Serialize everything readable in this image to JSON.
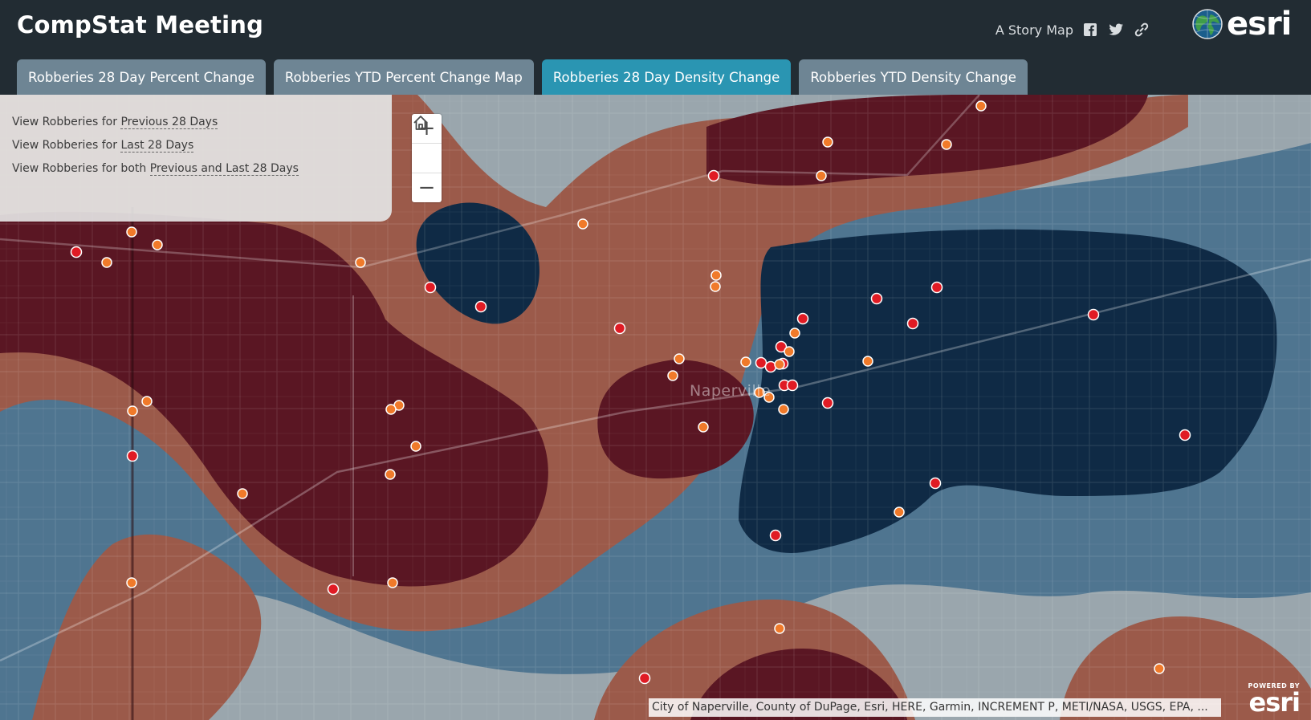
{
  "header": {
    "title": "CompStat Meeting",
    "story_map_label": "A Story Map",
    "brand": "esri"
  },
  "tabs": [
    {
      "label": "Robberies 28 Day Percent Change",
      "active": false
    },
    {
      "label": "Robberies YTD Percent Change Map",
      "active": false
    },
    {
      "label": "Robberies 28 Day Density Change",
      "active": true
    },
    {
      "label": "Robberies YTD Density Change",
      "active": false
    }
  ],
  "legend": {
    "rows": [
      {
        "prefix": "View Robberies for ",
        "link": "Previous 28 Days"
      },
      {
        "prefix": "View Robberies for ",
        "link": "Last 28 Days"
      },
      {
        "prefix": "View Robberies for both ",
        "link": "Previous and Last 28 Days"
      }
    ]
  },
  "zoom": {
    "in": "+",
    "home_icon": "home-icon",
    "out": "−"
  },
  "map": {
    "place_label": "Naperville",
    "attribution": "City of Naperville, County of DuPage, Esri, HERE, Garmin, INCREMENT P, METI/NASA, USGS, EPA, ...",
    "powered_small": "POWERED BY",
    "powered_big": "esri"
  },
  "colors": {
    "header_bg": "#222c33",
    "tab_inactive": "#6e8594",
    "tab_active": "#2a95b2",
    "density_high": "#5a1623",
    "density_mid_high": "#9b5a4a",
    "density_neutral": "#9aa6ad",
    "density_mid_low": "#4f7590",
    "density_low": "#0f2a45",
    "point_previous": "#e8541f",
    "point_last": "#d4131c"
  },
  "icons": [
    "facebook-icon",
    "twitter-icon",
    "link-icon",
    "esri-globe-icon"
  ]
}
